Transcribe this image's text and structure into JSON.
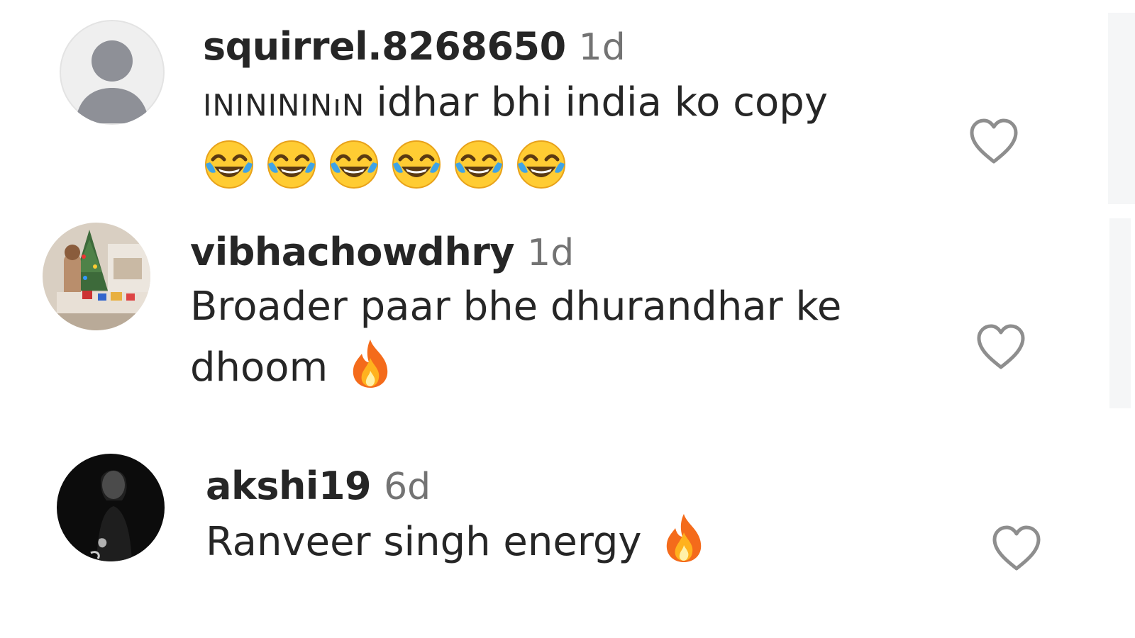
{
  "comments": [
    {
      "username": "squirrel.8268650",
      "time": "1d",
      "text_prefix": "ININININıN",
      "text": "idhar bhi india ko copy",
      "emoji": [
        "tears-of-joy",
        "tears-of-joy",
        "tears-of-joy",
        "tears-of-joy",
        "tears-of-joy",
        "tears-of-joy"
      ],
      "avatar": "default-avatar-icon"
    },
    {
      "username": "vibhachowdhry",
      "time": "1d",
      "text_line1": "Broader paar bhe dhurandhar ke",
      "text_line2": "dhoom",
      "emoji": [
        "fire"
      ],
      "avatar": "photo-avatar-christmas-tree"
    },
    {
      "username": "akshi19",
      "time": "6d",
      "text": "Ranveer singh energy",
      "emoji": [
        "fire"
      ],
      "avatar": "photo-avatar-dark-portrait"
    }
  ],
  "colors": {
    "username": "#262626",
    "timestamp": "#737373",
    "heart_stroke": "#8e8e8e",
    "placeholder_avatar_bg": "#efefef",
    "placeholder_avatar_fg": "#8e9097"
  }
}
